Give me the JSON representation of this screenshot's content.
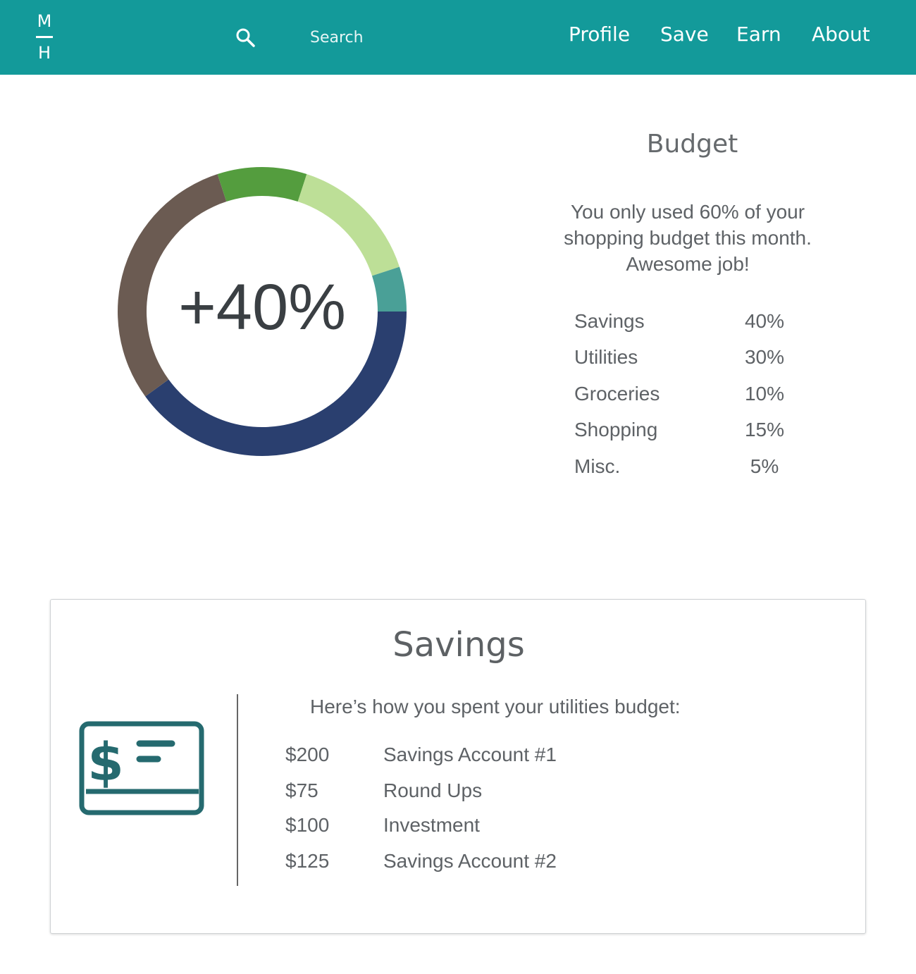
{
  "header": {
    "logo_top": "M",
    "logo_bottom": "H",
    "search_placeholder": "Search",
    "nav": [
      "Profile",
      "Save",
      "Earn",
      "About"
    ]
  },
  "budget": {
    "center_label": "+40%",
    "title": "Budget",
    "message": "You only used 60% of your shopping budget this month. Awesome job!",
    "breakdown": [
      {
        "label": "Savings",
        "value": "40%"
      },
      {
        "label": "Utilities",
        "value": "30%"
      },
      {
        "label": "Groceries",
        "value": "10%"
      },
      {
        "label": "Shopping",
        "value": "15%"
      },
      {
        "label": "Misc.",
        "value": "5%"
      }
    ]
  },
  "chart_data": {
    "type": "pie",
    "categories": [
      "Savings",
      "Utilities",
      "Groceries",
      "Shopping",
      "Misc."
    ],
    "values": [
      40,
      30,
      10,
      15,
      5
    ],
    "colors": [
      "#2a3f6f",
      "#6b5b52",
      "#549d3e",
      "#bddf97",
      "#4aa097"
    ]
  },
  "savings": {
    "title": "Savings",
    "subtitle": "Here’s how you spent your utilities budget:",
    "items": [
      {
        "amount": "$200",
        "desc": "Savings Account #1"
      },
      {
        "amount": "$75",
        "desc": "Round Ups"
      },
      {
        "amount": "$100",
        "desc": "Investment"
      },
      {
        "amount": "$125",
        "desc": "Savings Account #2"
      }
    ]
  },
  "colors": {
    "header": "#139a9a",
    "icon": "#256a6f"
  },
  "icons": [
    "search-icon",
    "money-card-icon"
  ]
}
